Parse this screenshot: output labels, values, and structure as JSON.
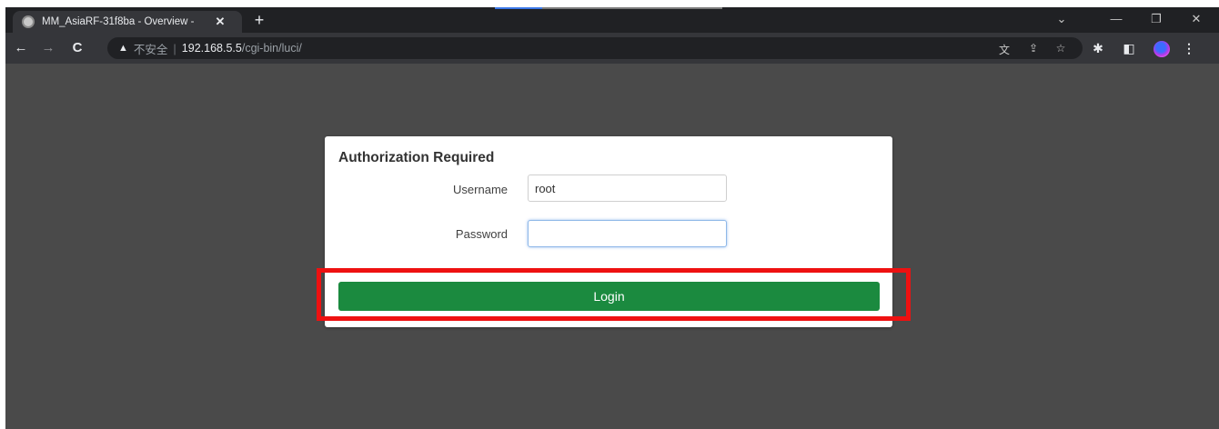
{
  "browser": {
    "tab_title": "MM_AsiaRF-31f8ba - Overview -",
    "tab_close": "✕",
    "new_tab": "+",
    "window_controls": [
      "⌄",
      "—",
      "❐",
      "✕"
    ],
    "toolbar_icons": [
      "back-icon",
      "forward-icon",
      "reload-icon"
    ],
    "security_label": "不安全",
    "url_host": "192.168.5.5",
    "url_path": "/cgi-bin/luci/",
    "omnibox_icons": [
      "translate-icon",
      "share-icon",
      "bookmark-star-icon"
    ],
    "extension_icons": [
      "extensions-icon",
      "side-panel-icon",
      "profile-icon",
      "menu-icon"
    ]
  },
  "login": {
    "title": "Authorization Required",
    "username_label": "Username",
    "username_value": "root",
    "password_label": "Password",
    "password_value": "",
    "button_label": "Login"
  },
  "colors": {
    "page_background": "#4a4a4a",
    "login_button": "#1b8a3f",
    "highlight": "#ee1111"
  }
}
